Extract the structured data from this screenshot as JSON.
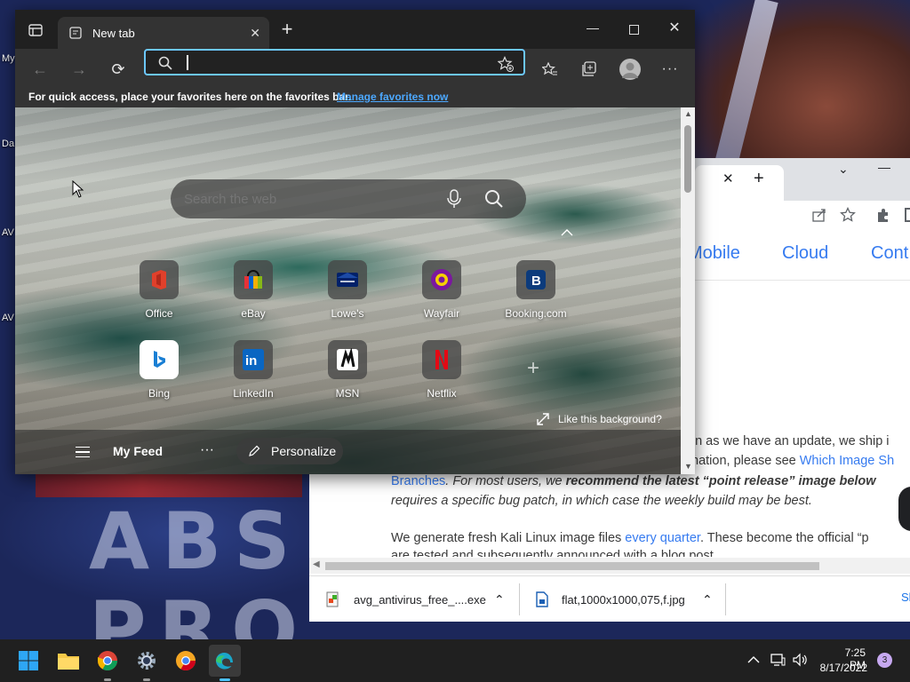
{
  "desktop": {
    "icon_labels": [
      "My",
      "Da",
      "AV",
      "AV"
    ],
    "wallpaper_text_line1": "ABS",
    "wallpaper_text_line2": "PRO"
  },
  "bg_window": {
    "nav_items": [
      "Mobile",
      "Cloud",
      "Cont"
    ],
    "para1_line1": "on as we have an update, we ship i",
    "para1_line2_prefix": "mation, please see ",
    "para1_line2_link": "Which Image Sh",
    "para1_line3_link": "Branches",
    "para1_line3_italic": ". For most users, we ",
    "para1_line3_bold": "recommend the latest “point release” image below",
    "para1_line4": "requires a specific bug patch, in which case the weekly build may be best.",
    "para2_prefix": "We generate fresh Kali Linux image files ",
    "para2_link": "every quarter",
    "para2_suffix": ". These become the official “p",
    "para2_line2": "are tested and subsequently announced with a blog post."
  },
  "downloads": [
    {
      "name": "avg_antivirus_free_....exe",
      "icon": "exe-file-icon"
    },
    {
      "name": "flat,1000x1000,075,f.jpg",
      "icon": "image-file-icon"
    }
  ],
  "downloads_show_all": "Sh",
  "edge": {
    "tab_title": "New tab",
    "address_value": "",
    "favbar_text": "For quick access, place your favorites here on the favorites bar.",
    "favbar_link": "Manage favorites now",
    "search_placeholder": "Search the web",
    "quick_links": [
      {
        "label": "Office",
        "icon": "office-icon"
      },
      {
        "label": "eBay",
        "icon": "ebay-icon"
      },
      {
        "label": "Lowe's",
        "icon": "lowes-icon"
      },
      {
        "label": "Wayfair",
        "icon": "wayfair-icon"
      },
      {
        "label": "Booking.com",
        "icon": "booking-icon"
      },
      {
        "label": "Bing",
        "icon": "bing-icon"
      },
      {
        "label": "LinkedIn",
        "icon": "linkedin-icon"
      },
      {
        "label": "MSN",
        "icon": "msn-icon"
      },
      {
        "label": "Netflix",
        "icon": "netflix-icon"
      }
    ],
    "like_background": "Like this background?",
    "my_feed": "My Feed",
    "personalize": "Personalize"
  },
  "taskbar": {
    "time": "7:25 PM",
    "date": "8/17/2022",
    "notification_count": "3",
    "apps": [
      "start-icon",
      "file-explorer-icon",
      "chrome-icon",
      "settings-icon",
      "chrome-alt-icon",
      "edge-icon"
    ]
  },
  "colors": {
    "edge_accent": "#6cc7ff",
    "link_blue": "#367bf0",
    "taskbar_bg": "#202020"
  }
}
